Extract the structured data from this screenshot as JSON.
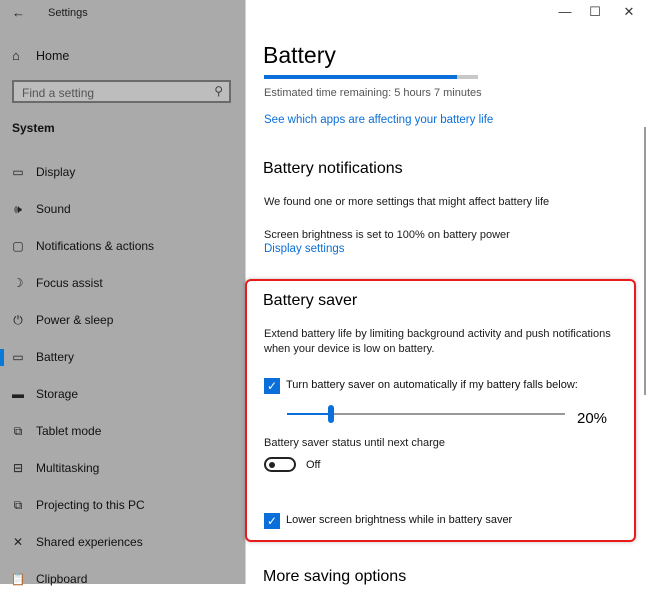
{
  "window": {
    "app_title": "Settings",
    "back_icon": "←",
    "controls": {
      "minimize": "—",
      "maximize": "☐",
      "close": "✕"
    }
  },
  "sidebar": {
    "home_label": "Home",
    "home_icon": "⌂",
    "search": {
      "placeholder": "Find a setting",
      "value": "",
      "icon": "⚲"
    },
    "section": "System",
    "items": [
      {
        "label": "Display",
        "icon": "▭",
        "selected": false
      },
      {
        "label": "Sound",
        "icon": "🕪",
        "selected": false
      },
      {
        "label": "Notifications & actions",
        "icon": "▢",
        "selected": false
      },
      {
        "label": "Focus assist",
        "icon": "☽",
        "selected": false
      },
      {
        "label": "Power & sleep",
        "icon": "⏻",
        "selected": false
      },
      {
        "label": "Battery",
        "icon": "▭",
        "selected": true
      },
      {
        "label": "Storage",
        "icon": "▬",
        "selected": false
      },
      {
        "label": "Tablet mode",
        "icon": "⧉",
        "selected": false
      },
      {
        "label": "Multitasking",
        "icon": "⊟",
        "selected": false
      },
      {
        "label": "Projecting to this PC",
        "icon": "⧉",
        "selected": false
      },
      {
        "label": "Shared experiences",
        "icon": "✕",
        "selected": false
      },
      {
        "label": "Clipboard",
        "icon": "📋",
        "selected": false
      }
    ]
  },
  "main": {
    "title": "Battery",
    "battery_level_percent": 90,
    "estimated_time": "Estimated time remaining: 5 hours 7 minutes",
    "apps_link": "See which apps are affecting your battery life",
    "notifications": {
      "heading": "Battery notifications",
      "found_text": "We found one or more settings that might affect battery life",
      "brightness_text": "Screen brightness is set to 100% on battery power",
      "display_link": "Display settings"
    },
    "battery_saver": {
      "heading": "Battery saver",
      "description_line1": "Extend battery life by limiting background activity and push notifications",
      "description_line2": "when your device is low on battery.",
      "auto_checkbox": {
        "label": "Turn battery saver on automatically if my battery falls below:",
        "checked": true
      },
      "threshold": {
        "value": 20,
        "min": 5,
        "max": 100,
        "display": "20%"
      },
      "status_label": "Battery saver status until next charge",
      "status_toggle": {
        "on": false,
        "label": "Off"
      },
      "brightness_checkbox": {
        "label": "Lower screen brightness while in battery saver",
        "checked": true
      },
      "check_glyph": "✓"
    },
    "more_heading": "More saving options"
  },
  "colors": {
    "accent": "#0a6fd8",
    "highlight_border": "#e81a1a",
    "sidebar_bg": "#aaaaaa"
  }
}
